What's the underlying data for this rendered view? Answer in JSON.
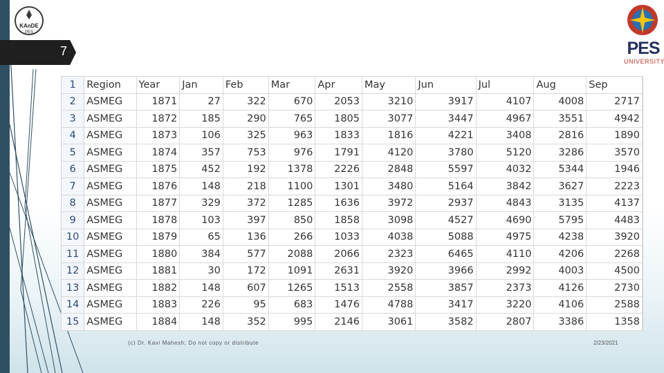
{
  "slide": {
    "number": "7"
  },
  "logos": {
    "left_text_top": "KAnDE",
    "left_text_bottom": "PES",
    "right_title": "PES",
    "right_subtitle": "UNIVERSITY"
  },
  "table": {
    "headers": [
      "1",
      "Region",
      "Year",
      "Jan",
      "Feb",
      "Mar",
      "Apr",
      "May",
      "Jun",
      "Jul",
      "Aug",
      "Sep"
    ],
    "rows": [
      [
        "2",
        "ASMEG",
        "1871",
        "27",
        "322",
        "670",
        "2053",
        "3210",
        "3917",
        "4107",
        "4008",
        "2717"
      ],
      [
        "3",
        "ASMEG",
        "1872",
        "185",
        "290",
        "765",
        "1805",
        "3077",
        "3447",
        "4967",
        "3551",
        "4942"
      ],
      [
        "4",
        "ASMEG",
        "1873",
        "106",
        "325",
        "963",
        "1833",
        "1816",
        "4221",
        "3408",
        "2816",
        "1890"
      ],
      [
        "5",
        "ASMEG",
        "1874",
        "357",
        "753",
        "976",
        "1791",
        "4120",
        "3780",
        "5120",
        "3286",
        "3570"
      ],
      [
        "6",
        "ASMEG",
        "1875",
        "452",
        "192",
        "1378",
        "2226",
        "2848",
        "5597",
        "4032",
        "5344",
        "1946"
      ],
      [
        "7",
        "ASMEG",
        "1876",
        "148",
        "218",
        "1100",
        "1301",
        "3480",
        "5164",
        "3842",
        "3627",
        "2223"
      ],
      [
        "8",
        "ASMEG",
        "1877",
        "329",
        "372",
        "1285",
        "1636",
        "3972",
        "2937",
        "4843",
        "3135",
        "4137"
      ],
      [
        "9",
        "ASMEG",
        "1878",
        "103",
        "397",
        "850",
        "1858",
        "3098",
        "4527",
        "4690",
        "5795",
        "4483"
      ],
      [
        "10",
        "ASMEG",
        "1879",
        "65",
        "136",
        "266",
        "1033",
        "4038",
        "5088",
        "4975",
        "4238",
        "3920"
      ],
      [
        "11",
        "ASMEG",
        "1880",
        "384",
        "577",
        "2088",
        "2066",
        "2323",
        "6465",
        "4110",
        "4206",
        "2268"
      ],
      [
        "12",
        "ASMEG",
        "1881",
        "30",
        "172",
        "1091",
        "2631",
        "3920",
        "3966",
        "2992",
        "4003",
        "4500"
      ],
      [
        "13",
        "ASMEG",
        "1882",
        "148",
        "607",
        "1265",
        "1513",
        "2558",
        "3857",
        "2373",
        "4126",
        "2730"
      ],
      [
        "14",
        "ASMEG",
        "1883",
        "226",
        "95",
        "683",
        "1476",
        "4788",
        "3417",
        "3220",
        "4106",
        "2588"
      ],
      [
        "15",
        "ASMEG",
        "1884",
        "148",
        "352",
        "995",
        "2146",
        "3061",
        "3582",
        "2807",
        "3386",
        "1358"
      ]
    ]
  },
  "footer": {
    "copyright": "(c) Dr. Kavi Mahesh; Do not copy or distribute",
    "date": "2/23/2021"
  }
}
